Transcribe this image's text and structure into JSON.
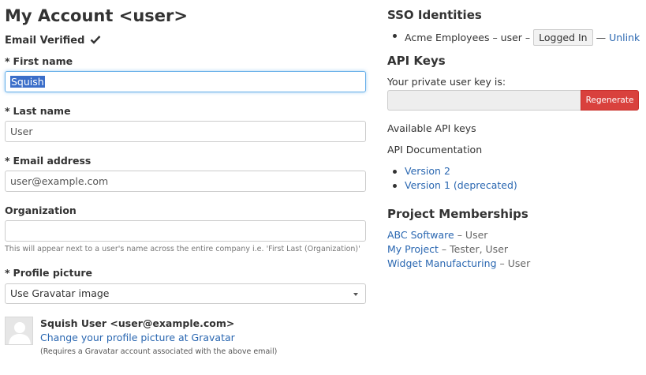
{
  "account": {
    "title": "My Account <user>",
    "email_verified": "Email Verified"
  },
  "form": {
    "required_marker": "*",
    "first_name": {
      "label": "First name",
      "value": "Squish"
    },
    "last_name": {
      "label": "Last name",
      "value": "User"
    },
    "email": {
      "label": "Email address",
      "value": "user@example.com"
    },
    "organization": {
      "label": "Organization",
      "value": "",
      "help": "This will appear next to a user's name across the entire company i.e. 'First Last (Organization)'"
    },
    "profile_picture": {
      "label": "Profile picture",
      "selected": "Use Gravatar image"
    }
  },
  "gravatar": {
    "name": "Squish User <user@example.com>",
    "change_link": "Change your profile picture at Gravatar",
    "note": "(Requires a Gravatar account associated with the above email)"
  },
  "sso": {
    "title": "SSO Identities",
    "items": [
      {
        "text": "Acme Employees – user –",
        "status": "Logged In",
        "separator": "—",
        "action": "Unlink"
      }
    ]
  },
  "api": {
    "title": "API Keys",
    "private_key_label": "Your private user key is:",
    "private_key_value": "",
    "regenerate_label": "Regenerate",
    "available_keys": "Available API keys",
    "docs_label": "API Documentation",
    "docs": [
      "Version 2",
      "Version 1 (deprecated)"
    ]
  },
  "memberships": {
    "title": "Project Memberships",
    "items": [
      {
        "project": "ABC Software",
        "role": "– User"
      },
      {
        "project": "My Project",
        "role": "– Tester, User"
      },
      {
        "project": "Widget Manufacturing",
        "role": "– User"
      }
    ]
  },
  "colors": {
    "link": "#2a67b1",
    "danger": "#d9413d",
    "focus": "#66afe9",
    "selection": "#3b6ec9"
  }
}
